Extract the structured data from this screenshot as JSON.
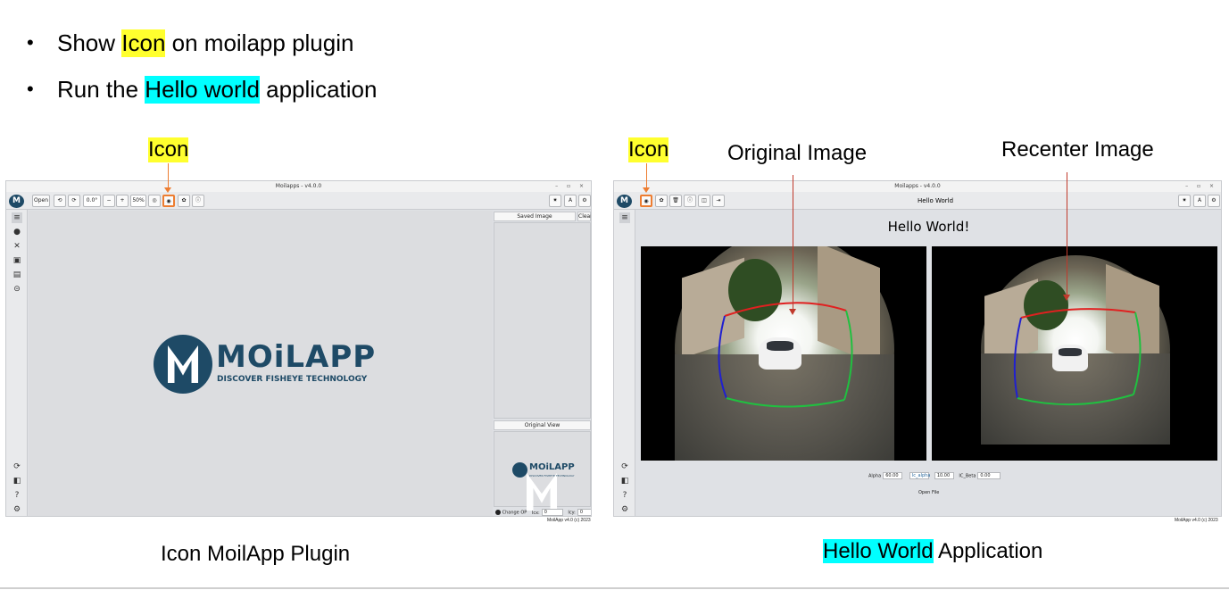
{
  "bullets": [
    {
      "pre": "Show ",
      "highlight": "Icon",
      "post": " on moilapp plugin",
      "highlight_color": "#ffff2e"
    },
    {
      "pre": "Run the ",
      "highlight": "Hello world",
      "post": " application",
      "highlight_color": "#00ffff"
    }
  ],
  "labels": {
    "icon_left": "Icon",
    "icon_right": "Icon",
    "original_image": "Original Image",
    "recenter_image": "Recenter Image"
  },
  "captions": {
    "left": "Icon MoilApp Plugin",
    "right_highlight": "Hello World",
    "right_rest": " Application"
  },
  "window1": {
    "title": "Moilapps - v4.0.0",
    "controls": "– ▫ ×",
    "toolbar": {
      "open": "Open",
      "rotate_left": "⟲",
      "rotate_right": "⟳",
      "angle": "0.0°",
      "zoom_out": "−",
      "zoom_in": "+",
      "zoom": "50%",
      "reset_view": "◎",
      "plugin_icon": "◉",
      "plugin_store": "✿",
      "about": "ⓘ",
      "theme": "✷",
      "font": "A",
      "settings": "⚙"
    },
    "sidebar_top": [
      "≡",
      "●",
      "✕",
      "▣",
      "▤",
      "⊝"
    ],
    "sidebar_bottom": [
      "⟳",
      "◧",
      "?",
      "⚙"
    ],
    "logo_word": "MOiLAPP",
    "logo_tagline": "DISCOVER FISHEYE TECHNOLOGY",
    "saved_image": "Saved Image",
    "clear": "Clear",
    "original_view": "Original View",
    "mini_logo_word": "MOiLAPP",
    "mini_logo_tagline": "DISCOVER FISHEYE TECHNOLOGY",
    "change_op": "Change OP",
    "icx_label": "Icx:",
    "icx_value": "0",
    "icy_label": "Icy:",
    "icy_value": "0",
    "footer": "MoilApp v4.0 (c) 2023"
  },
  "window2": {
    "title": "Moilapps - v4.0.0",
    "controls": "– ▫ ×",
    "header": "Hello World",
    "toolbar": {
      "plugin_icon": "◉",
      "plugin_store": "✿",
      "delete": "🗑",
      "about": "ⓘ",
      "window": "◫",
      "exit": "⇥",
      "theme": "✷",
      "font": "A",
      "settings": "⚙"
    },
    "sidebar_top": [
      "≡"
    ],
    "sidebar_bottom": [
      "⟳",
      "◧",
      "?",
      "⚙"
    ],
    "hello": "Hello World!",
    "alpha_label": "Alpha",
    "alpha_value": "60.00",
    "ic_alpha_label": "Ic_alpha",
    "ic_alpha_value": "10.00",
    "ic_beta_label": "IC_Beta",
    "ic_beta_value": "0.00",
    "open_file": "Open File",
    "footer": "MoilApp v4.0 (c) 2023"
  },
  "colors": {
    "accent_orange": "#ed7d31",
    "annotation_red": "#c0392b",
    "brand_blue": "#1e4a66"
  }
}
